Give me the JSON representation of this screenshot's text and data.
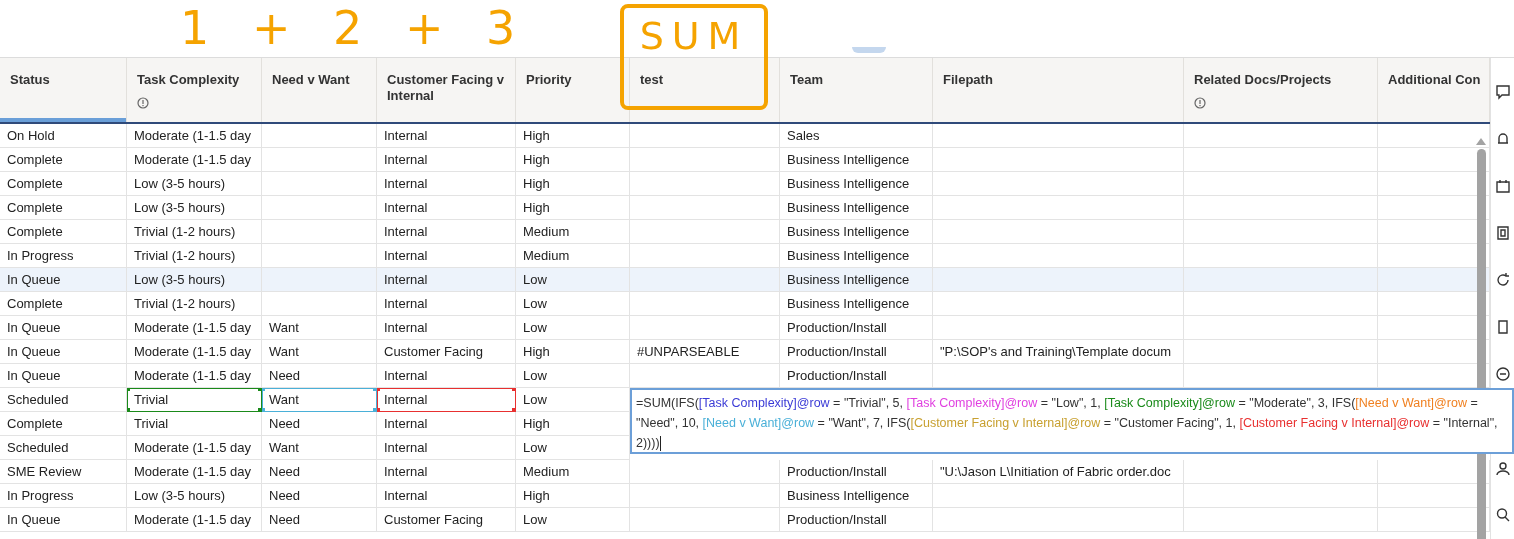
{
  "annotations": {
    "sum_parts": "1 + 2 + 3",
    "boxed": "SUM"
  },
  "columns": [
    {
      "label": "Status",
      "info": false,
      "selected": true
    },
    {
      "label": "Task Complexity",
      "info": true,
      "selected": false
    },
    {
      "label": "Need v Want",
      "info": false,
      "selected": false
    },
    {
      "label": "Customer Facing v Internal",
      "info": false,
      "selected": false
    },
    {
      "label": "Priority",
      "info": false,
      "selected": false
    },
    {
      "label": "test",
      "info": false,
      "selected": false
    },
    {
      "label": "Team",
      "info": false,
      "selected": false
    },
    {
      "label": "Filepath",
      "info": false,
      "selected": false
    },
    {
      "label": "Related Docs/Projects",
      "info": true,
      "selected": false
    },
    {
      "label": "Additional Con",
      "info": false,
      "selected": false
    }
  ],
  "rows": [
    {
      "selected": false,
      "cells": [
        "On Hold",
        "Moderate (1-1.5 day",
        null,
        "Internal",
        "High",
        null,
        "Sales",
        null,
        null,
        null
      ]
    },
    {
      "selected": false,
      "cells": [
        "Complete",
        "Moderate (1-1.5 day",
        null,
        "Internal",
        "High",
        null,
        "Business Intelligence",
        null,
        null,
        null
      ]
    },
    {
      "selected": false,
      "cells": [
        "Complete",
        "Low (3-5 hours)",
        null,
        "Internal",
        "High",
        null,
        "Business Intelligence",
        null,
        null,
        null
      ]
    },
    {
      "selected": false,
      "cells": [
        "Complete",
        "Low (3-5 hours)",
        null,
        "Internal",
        "High",
        null,
        "Business Intelligence",
        null,
        null,
        null
      ]
    },
    {
      "selected": false,
      "cells": [
        "Complete",
        "Trivial (1-2 hours)",
        null,
        "Internal",
        "Medium",
        null,
        "Business Intelligence",
        null,
        null,
        null
      ]
    },
    {
      "selected": false,
      "cells": [
        "In Progress",
        "Trivial (1-2 hours)",
        null,
        "Internal",
        "Medium",
        null,
        "Business Intelligence",
        null,
        null,
        null
      ]
    },
    {
      "selected": true,
      "cells": [
        "In Queue",
        "Low (3-5 hours)",
        null,
        "Internal",
        "Low",
        null,
        "Business Intelligence",
        null,
        null,
        null
      ]
    },
    {
      "selected": false,
      "cells": [
        "Complete",
        "Trivial (1-2 hours)",
        null,
        "Internal",
        "Low",
        null,
        "Business Intelligence",
        null,
        null,
        null
      ]
    },
    {
      "selected": false,
      "cells": [
        "In Queue",
        "Moderate (1-1.5 day",
        "Want",
        "Internal",
        "Low",
        null,
        "Production/Install",
        null,
        null,
        null
      ]
    },
    {
      "selected": false,
      "cells": [
        "In Queue",
        "Moderate (1-1.5 day",
        "Want",
        "Customer Facing",
        "High",
        "#UNPARSEABLE",
        "Production/Install",
        "\"P:\\SOP's and Training\\Template docum",
        null,
        null
      ]
    },
    {
      "selected": false,
      "cells": [
        "In Queue",
        "Moderate (1-1.5 day",
        "Need",
        "Internal",
        "Low",
        null,
        "Production/Install",
        null,
        null,
        null
      ]
    },
    {
      "selected": false,
      "cells": [
        "Scheduled",
        {
          "text": "Trivial",
          "color": "#1a8a1a"
        },
        {
          "text": "Want",
          "color": "#4ab0d8"
        },
        {
          "text": "Internal",
          "color": "#e83030"
        },
        "Low",
        null,
        null,
        null,
        null,
        null
      ]
    },
    {
      "selected": false,
      "cells": [
        "Complete",
        "Trivial",
        "Need",
        "Internal",
        "High",
        null,
        null,
        null,
        null,
        null
      ]
    },
    {
      "selected": false,
      "cells": [
        "Scheduled",
        "Moderate (1-1.5 day",
        "Want",
        "Internal",
        "Low",
        null,
        null,
        null,
        null,
        null
      ]
    },
    {
      "selected": false,
      "cells": [
        "SME Review",
        "Moderate (1-1.5 day",
        "Need",
        "Internal",
        "Medium",
        null,
        "Production/Install",
        "\"U:\\Jason L\\Initiation of Fabric order.doc",
        null,
        null
      ]
    },
    {
      "selected": false,
      "cells": [
        "In Progress",
        "Low (3-5 hours)",
        "Need",
        "Internal",
        "High",
        null,
        "Business Intelligence",
        null,
        null,
        null
      ]
    },
    {
      "selected": false,
      "cells": [
        "In Queue",
        "Moderate (1-1.5 day",
        "Need",
        "Customer Facing",
        "Low",
        null,
        "Production/Install",
        null,
        null,
        null
      ]
    }
  ],
  "formula_editor": {
    "segments": [
      {
        "text": "=SUM(IFS(",
        "color": "#333333"
      },
      {
        "text": "[Task Complexity]@row",
        "color": "#3b3bd6"
      },
      {
        "text": " = \"Trivial\", 5, ",
        "color": "#333333"
      },
      {
        "text": "[Task Complexity]@row",
        "color": "#e040e0"
      },
      {
        "text": " = \"Low\", 1, ",
        "color": "#333333"
      },
      {
        "text": "[Task Complexity]@row",
        "color": "#1a8a1a"
      },
      {
        "text": " = \"Moderate\", 3, IFS(",
        "color": "#333333"
      },
      {
        "text": "[Need v Want]@row",
        "color": "#f08020"
      },
      {
        "text": " = \"Need\", 10, ",
        "color": "#333333"
      },
      {
        "text": "[Need v Want]@row",
        "color": "#4ab0d8"
      },
      {
        "text": " = \"Want\", 7, IFS(",
        "color": "#333333"
      },
      {
        "text": "[Customer Facing v Internal]@row",
        "color": "#c8a030"
      },
      {
        "text": " = \"Customer Facing\", 1, ",
        "color": "#333333"
      },
      {
        "text": "[Customer Facing v Internal]@row",
        "color": "#e83030"
      },
      {
        "text": " = \"Internal\", 2))))",
        "color": "#333333"
      }
    ]
  }
}
